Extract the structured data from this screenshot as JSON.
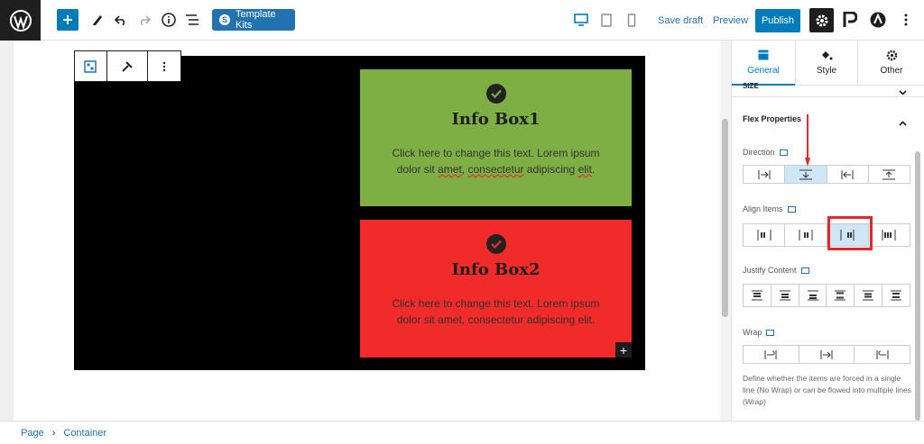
{
  "topbar": {
    "template_kits_label": "Template Kits",
    "save_draft": "Save draft",
    "preview": "Preview",
    "publish": "Publish"
  },
  "canvas": {
    "box1": {
      "title": "Info Box1",
      "text_a": "Click here to change this text. Lorem ipsum dolor sit ",
      "ul1": "amet",
      "text_b": ", ",
      "ul2": "consectetur",
      "text_c": " adipiscing ",
      "ul3": "elit",
      "text_d": ".",
      "color": "#7eaf44"
    },
    "box2": {
      "title": "Info Box2",
      "text_a": "Click here to change this text. Lorem ipsum dolor sit ",
      "ul1": "amet",
      "text_b": ", ",
      "ul2": "consectetur",
      "text_c": " adipiscing ",
      "ul3": "elit",
      "text_d": ".",
      "color": "#f12a2a"
    }
  },
  "statusbar": {
    "crumbs": [
      "Page",
      "Container"
    ]
  },
  "sidebar": {
    "tabs": [
      "General",
      "Style",
      "Other"
    ],
    "size_label": "Size",
    "section_title": "Flex Properties",
    "direction_label": "Direction",
    "align_items_label": "Align Items",
    "justify_content_label": "Justify Content",
    "wrap_label": "Wrap",
    "wrap_description": "Define whether the items are forced in a single line (No Wrap) or can be flowed into multiple lines (Wrap)",
    "accent": "#007cba",
    "highlight": "#e0292e"
  }
}
